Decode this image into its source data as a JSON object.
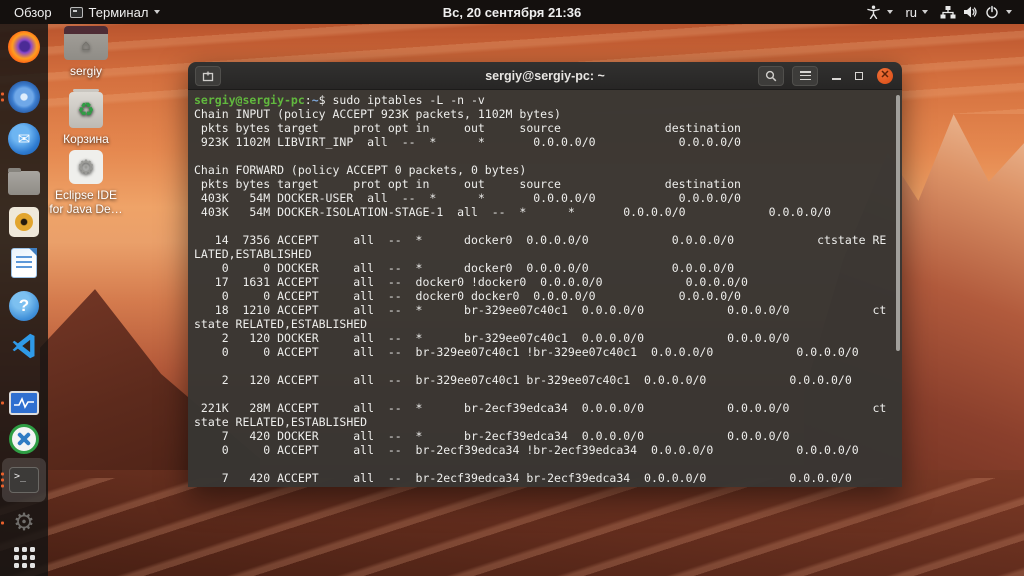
{
  "top_bar": {
    "activities_label": "Обзор",
    "focused_app": "Терминал",
    "clock": "Вс, 20 сентября  21:36",
    "keyboard_layout": "ru"
  },
  "desktop_icons": {
    "home_label": "sergiy",
    "trash_label": "Корзина",
    "eclipse_label_line1": "Eclipse IDE",
    "eclipse_label_line2": "for Java De…"
  },
  "window": {
    "title": "sergiy@sergiy-pc: ~"
  },
  "terminal": {
    "prompt_user_host": "sergiy@sergiy-pc",
    "prompt_separator": ":",
    "prompt_path": "~",
    "prompt_command": "$ sudo iptables -L -n -v",
    "lines": [
      "Chain INPUT (policy ACCEPT 923K packets, 1102M bytes)",
      " pkts bytes target     prot opt in     out     source               destination",
      " 923K 1102M LIBVIRT_INP  all  --  *      *       0.0.0.0/0            0.0.0.0/0",
      "",
      "Chain FORWARD (policy ACCEPT 0 packets, 0 bytes)",
      " pkts bytes target     prot opt in     out     source               destination",
      " 403K   54M DOCKER-USER  all  --  *      *       0.0.0.0/0            0.0.0.0/0",
      " 403K   54M DOCKER-ISOLATION-STAGE-1  all  --  *      *       0.0.0.0/0            0.0.0.0/0",
      "",
      "   14  7356 ACCEPT     all  --  *      docker0  0.0.0.0/0            0.0.0.0/0            ctstate RE",
      "LATED,ESTABLISHED",
      "    0     0 DOCKER     all  --  *      docker0  0.0.0.0/0            0.0.0.0/0",
      "   17  1631 ACCEPT     all  --  docker0 !docker0  0.0.0.0/0            0.0.0.0/0",
      "    0     0 ACCEPT     all  --  docker0 docker0  0.0.0.0/0            0.0.0.0/0",
      "   18  1210 ACCEPT     all  --  *      br-329ee07c40c1  0.0.0.0/0            0.0.0.0/0            ct",
      "state RELATED,ESTABLISHED",
      "    2   120 DOCKER     all  --  *      br-329ee07c40c1  0.0.0.0/0            0.0.0.0/0",
      "    0     0 ACCEPT     all  --  br-329ee07c40c1 !br-329ee07c40c1  0.0.0.0/0            0.0.0.0/0",
      "",
      "    2   120 ACCEPT     all  --  br-329ee07c40c1 br-329ee07c40c1  0.0.0.0/0            0.0.0.0/0",
      "",
      " 221K   28M ACCEPT     all  --  *      br-2ecf39edca34  0.0.0.0/0            0.0.0.0/0            ct",
      "state RELATED,ESTABLISHED",
      "    7   420 DOCKER     all  --  *      br-2ecf39edca34  0.0.0.0/0            0.0.0.0/0",
      "    0     0 ACCEPT     all  --  br-2ecf39edca34 !br-2ecf39edca34  0.0.0.0/0            0.0.0.0/0",
      "",
      "    7   420 ACCEPT     all  --  br-2ecf39edca34 br-2ecf39edca34  0.0.0.0/0            0.0.0.0/0"
    ]
  },
  "icons": {
    "terminal_glyph": ">_",
    "help_glyph": "?",
    "envelope_glyph": "✉",
    "recycle_glyph": "♻",
    "gear_glyph": "⚙",
    "home_glyph": "⌂",
    "close_glyph": "✕"
  },
  "colors": {
    "accent_orange": "#e8612c",
    "prompt_green": "#61b83e",
    "path_blue": "#7ea6d8",
    "terminal_bg": "#383633",
    "topbar_bg": "#0e0e0e"
  }
}
